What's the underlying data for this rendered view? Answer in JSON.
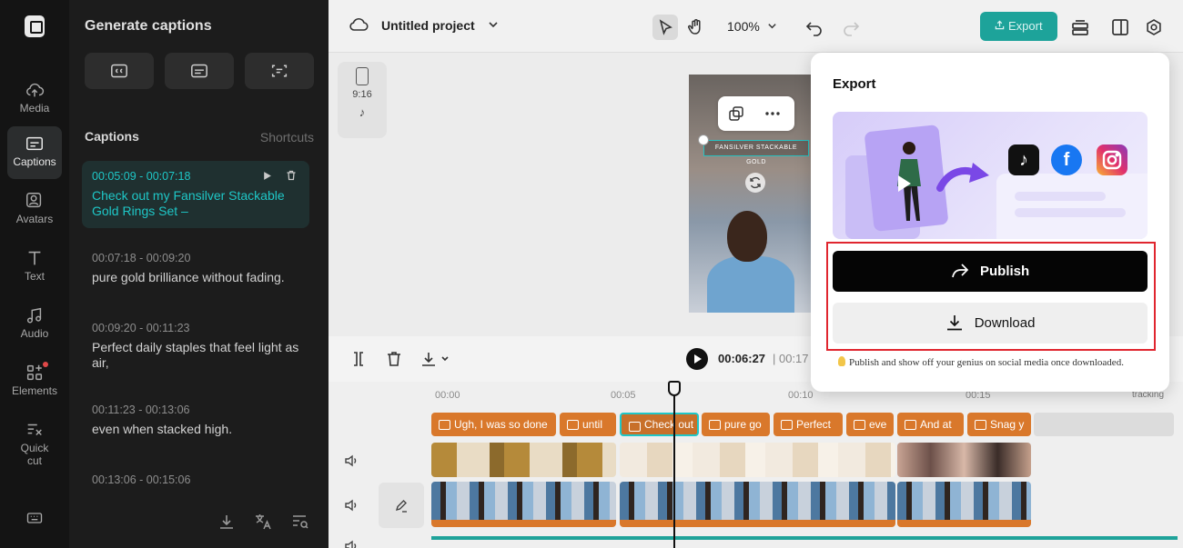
{
  "rail": {
    "items": [
      {
        "label": "Media",
        "icon": "cloud-upload-icon"
      },
      {
        "label": "Captions",
        "icon": "captions-icon"
      },
      {
        "label": "Avatars",
        "icon": "avatar-icon"
      },
      {
        "label": "Text",
        "icon": "text-icon"
      },
      {
        "label": "Audio",
        "icon": "music-icon"
      },
      {
        "label": "Elements",
        "icon": "elements-icon"
      },
      {
        "label": "Quick",
        "label2": "cut",
        "icon": "quick-cut-icon"
      }
    ],
    "active": "Captions"
  },
  "panel": {
    "title": "Generate captions",
    "captions_title": "Captions",
    "shortcuts": "Shortcuts",
    "captions": [
      {
        "time": "00:05:09 - 00:07:18",
        "text": "Check out my Fansilver Stackable Gold Rings Set –"
      },
      {
        "time": "00:07:18 - 00:09:20",
        "text": "pure gold brilliance without fading."
      },
      {
        "time": "00:09:20 - 00:11:23",
        "text": "Perfect daily staples that feel light as air,"
      },
      {
        "time": "00:11:23 - 00:13:06",
        "text": "even when stacked high."
      },
      {
        "time": "00:13:06 - 00:15:06",
        "text": ""
      }
    ]
  },
  "topbar": {
    "project_name": "Untitled project",
    "zoom": "100%",
    "export_label": "Export"
  },
  "canvas": {
    "ratio_label": "9:16",
    "subtitle_overlay": "FANSILVER STACKABLE GOLD"
  },
  "timeline": {
    "current_time": "00:06:27",
    "total_time": "| 00:17",
    "ruler": [
      "00:00",
      "00:05",
      "00:10",
      "00:15"
    ],
    "tracking_label": "tracking",
    "caption_chips": [
      "Ugh, I was so done",
      "until",
      "Check out m",
      "pure go",
      "Perfect",
      "eve",
      "And at",
      "Snag y"
    ]
  },
  "export_modal": {
    "title": "Export",
    "publish_label": "Publish",
    "download_label": "Download",
    "tip": "Publish and show off your genius on social media once downloaded."
  },
  "colors": {
    "accent": "#1da39a",
    "caption_chip": "#d9782b",
    "highlight": "#e0262f"
  }
}
